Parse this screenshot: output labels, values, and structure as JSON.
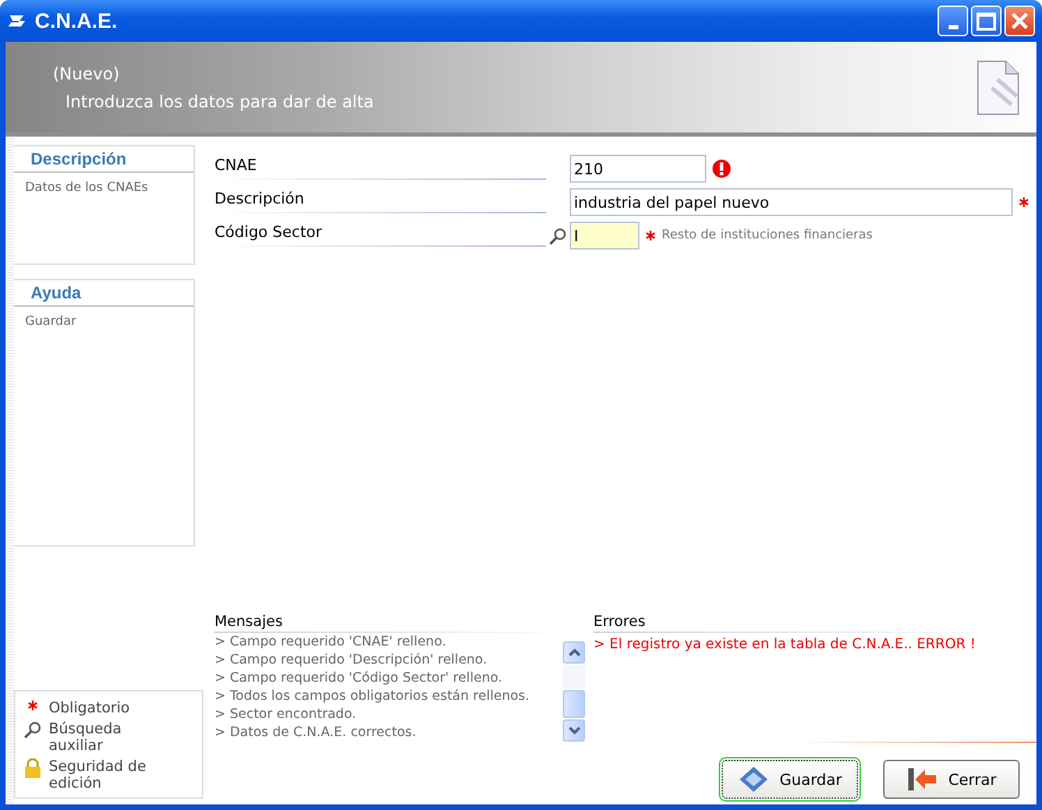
{
  "window": {
    "title": "C.N.A.E."
  },
  "header": {
    "mode": "(Nuevo)",
    "subtitle": "Introduzca los datos para dar de alta"
  },
  "sidebar": {
    "panels": [
      {
        "title": "Descripción",
        "text": "Datos de los CNAEs"
      },
      {
        "title": "Ayuda",
        "text": "Guardar"
      }
    ],
    "legend": [
      {
        "kind": "required",
        "label": "Obligatorio"
      },
      {
        "kind": "search",
        "label": "Búsqueda auxiliar"
      },
      {
        "kind": "lock",
        "label": "Seguridad de edición"
      }
    ]
  },
  "form": {
    "fields": [
      {
        "label": "CNAE",
        "value": "210",
        "error": true,
        "required": false,
        "lookup": false,
        "highlighted": false
      },
      {
        "label": "Descripción",
        "value": "industria del papel nuevo",
        "error": false,
        "required": true,
        "lookup": false,
        "highlighted": false
      },
      {
        "label": "Código Sector",
        "value": "I",
        "error": false,
        "required": true,
        "lookup": true,
        "highlighted": true,
        "note": "Resto de instituciones financieras"
      }
    ]
  },
  "messages": {
    "title": "Mensajes",
    "lines": [
      "> Campo requerido 'CNAE' relleno.",
      "> Campo requerido 'Descripción' relleno.",
      "> Campo requerido 'Código Sector' relleno.",
      "> Todos los campos obligatorios están rellenos.",
      "> Sector encontrado.",
      "> Datos de C.N.A.E. correctos."
    ]
  },
  "errors": {
    "title": "Errores",
    "lines": [
      "> El registro ya existe en la tabla de C.N.A.E.. ERROR !"
    ]
  },
  "buttons": [
    {
      "kind": "save",
      "label": "Guardar",
      "focused": true
    },
    {
      "kind": "close",
      "label": "Cerrar",
      "focused": false
    }
  ]
}
